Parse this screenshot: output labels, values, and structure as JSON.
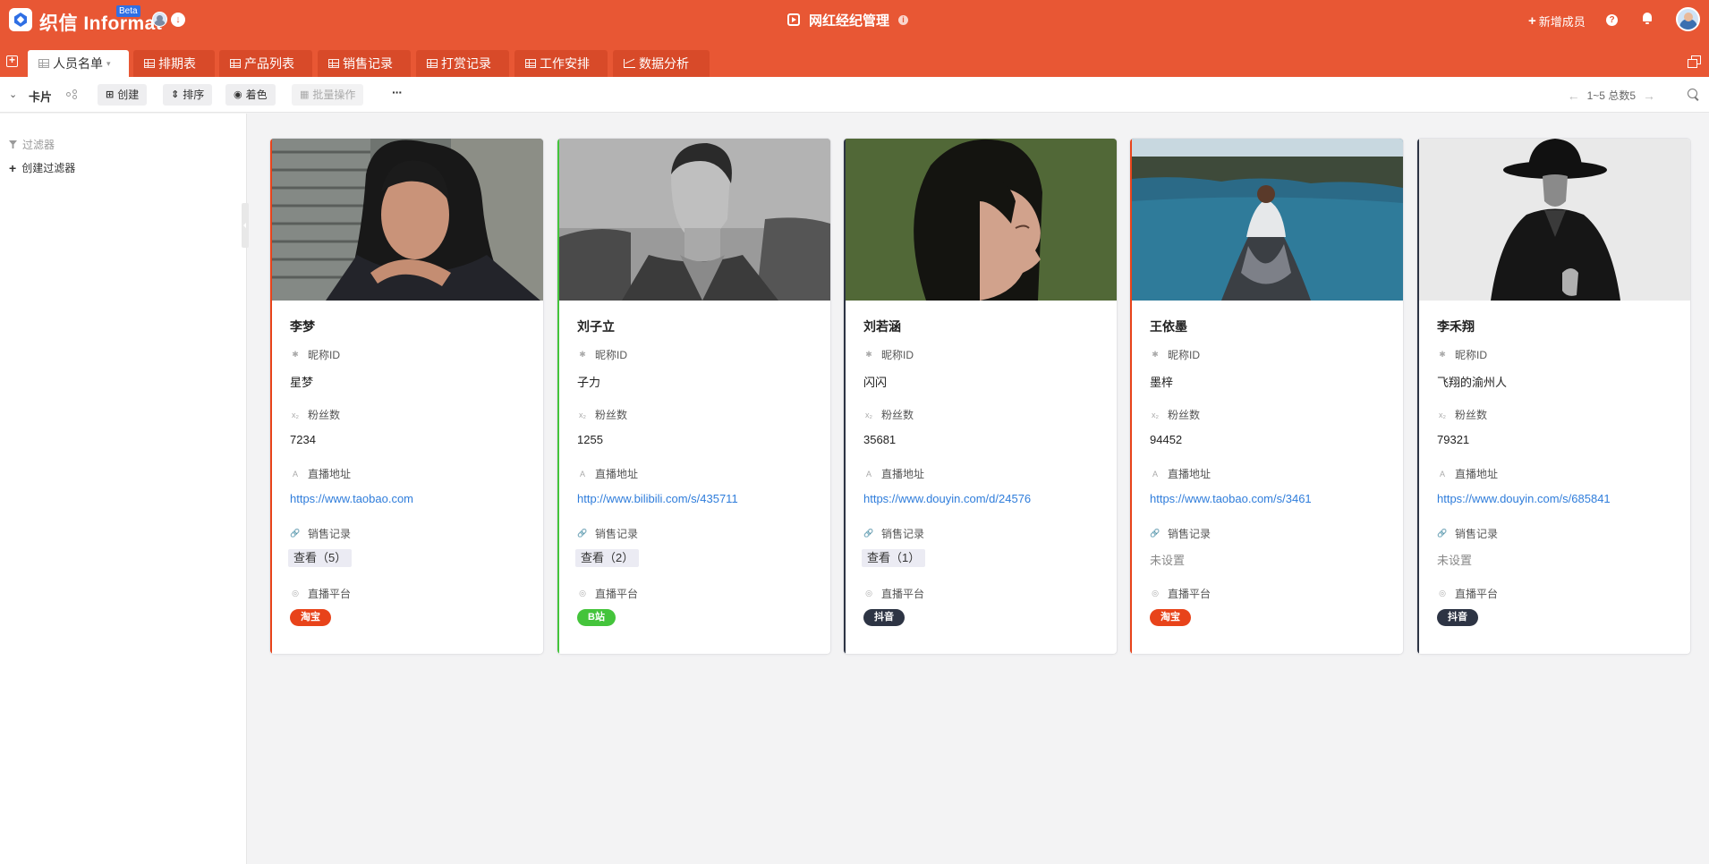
{
  "app": {
    "brand": "织信 Informat",
    "beta": "Beta",
    "title": "网红经纪管理",
    "add_member": "新增成员"
  },
  "tabs": [
    {
      "label": "人员名单",
      "icon": "grid-icon",
      "active": true
    },
    {
      "label": "排期表",
      "icon": "grid-icon"
    },
    {
      "label": "产品列表",
      "icon": "grid-icon"
    },
    {
      "label": "销售记录",
      "icon": "grid-icon"
    },
    {
      "label": "打赏记录",
      "icon": "grid-icon"
    },
    {
      "label": "工作安排",
      "icon": "grid-icon"
    },
    {
      "label": "数据分析",
      "icon": "line-chart-icon"
    }
  ],
  "toolbar": {
    "view_name": "卡片",
    "create": "创建",
    "sort": "排序",
    "color": "着色",
    "batch": "批量操作",
    "more": "···",
    "pager": "1~5 总数5"
  },
  "sidebar": {
    "filter_title": "过滤器",
    "create_filter": "创建过滤器"
  },
  "labels": {
    "nickname": "昵称ID",
    "fans": "粉丝数",
    "live_url": "直播地址",
    "sales": "销售记录",
    "platform": "直播平台"
  },
  "colors": {
    "brand": "#e85734",
    "link": "#2f7ddb",
    "taobao": "#e8431a",
    "bilibili": "#44c43b",
    "douyin": "#2d3444"
  },
  "cards": [
    {
      "name": "李梦",
      "nickname": "星梦",
      "fans": "7234",
      "url": "https://www.taobao.com",
      "sales": "查看（5）",
      "platform": "淘宝",
      "accent": "#e8431a"
    },
    {
      "name": "刘子立",
      "nickname": "子力",
      "fans": "1255",
      "url": "http://www.bilibili.com/s/435711",
      "sales": "查看（2）",
      "platform": "B站",
      "accent": "#44c43b"
    },
    {
      "name": "刘若涵",
      "nickname": "闪闪",
      "fans": "35681",
      "url": "https://www.douyin.com/d/24576",
      "sales": "查看（1）",
      "platform": "抖音",
      "accent": "#2d3444"
    },
    {
      "name": "王依墨",
      "nickname": "墨梓",
      "fans": "94452",
      "url": "https://www.taobao.com/s/3461",
      "sales": "未设置",
      "platform": "淘宝",
      "accent": "#e8431a"
    },
    {
      "name": "李禾翔",
      "nickname": "飞翔的渝州人",
      "fans": "79321",
      "url": "https://www.douyin.com/s/685841",
      "sales": "未设置",
      "platform": "抖音",
      "accent": "#2d3444"
    }
  ]
}
